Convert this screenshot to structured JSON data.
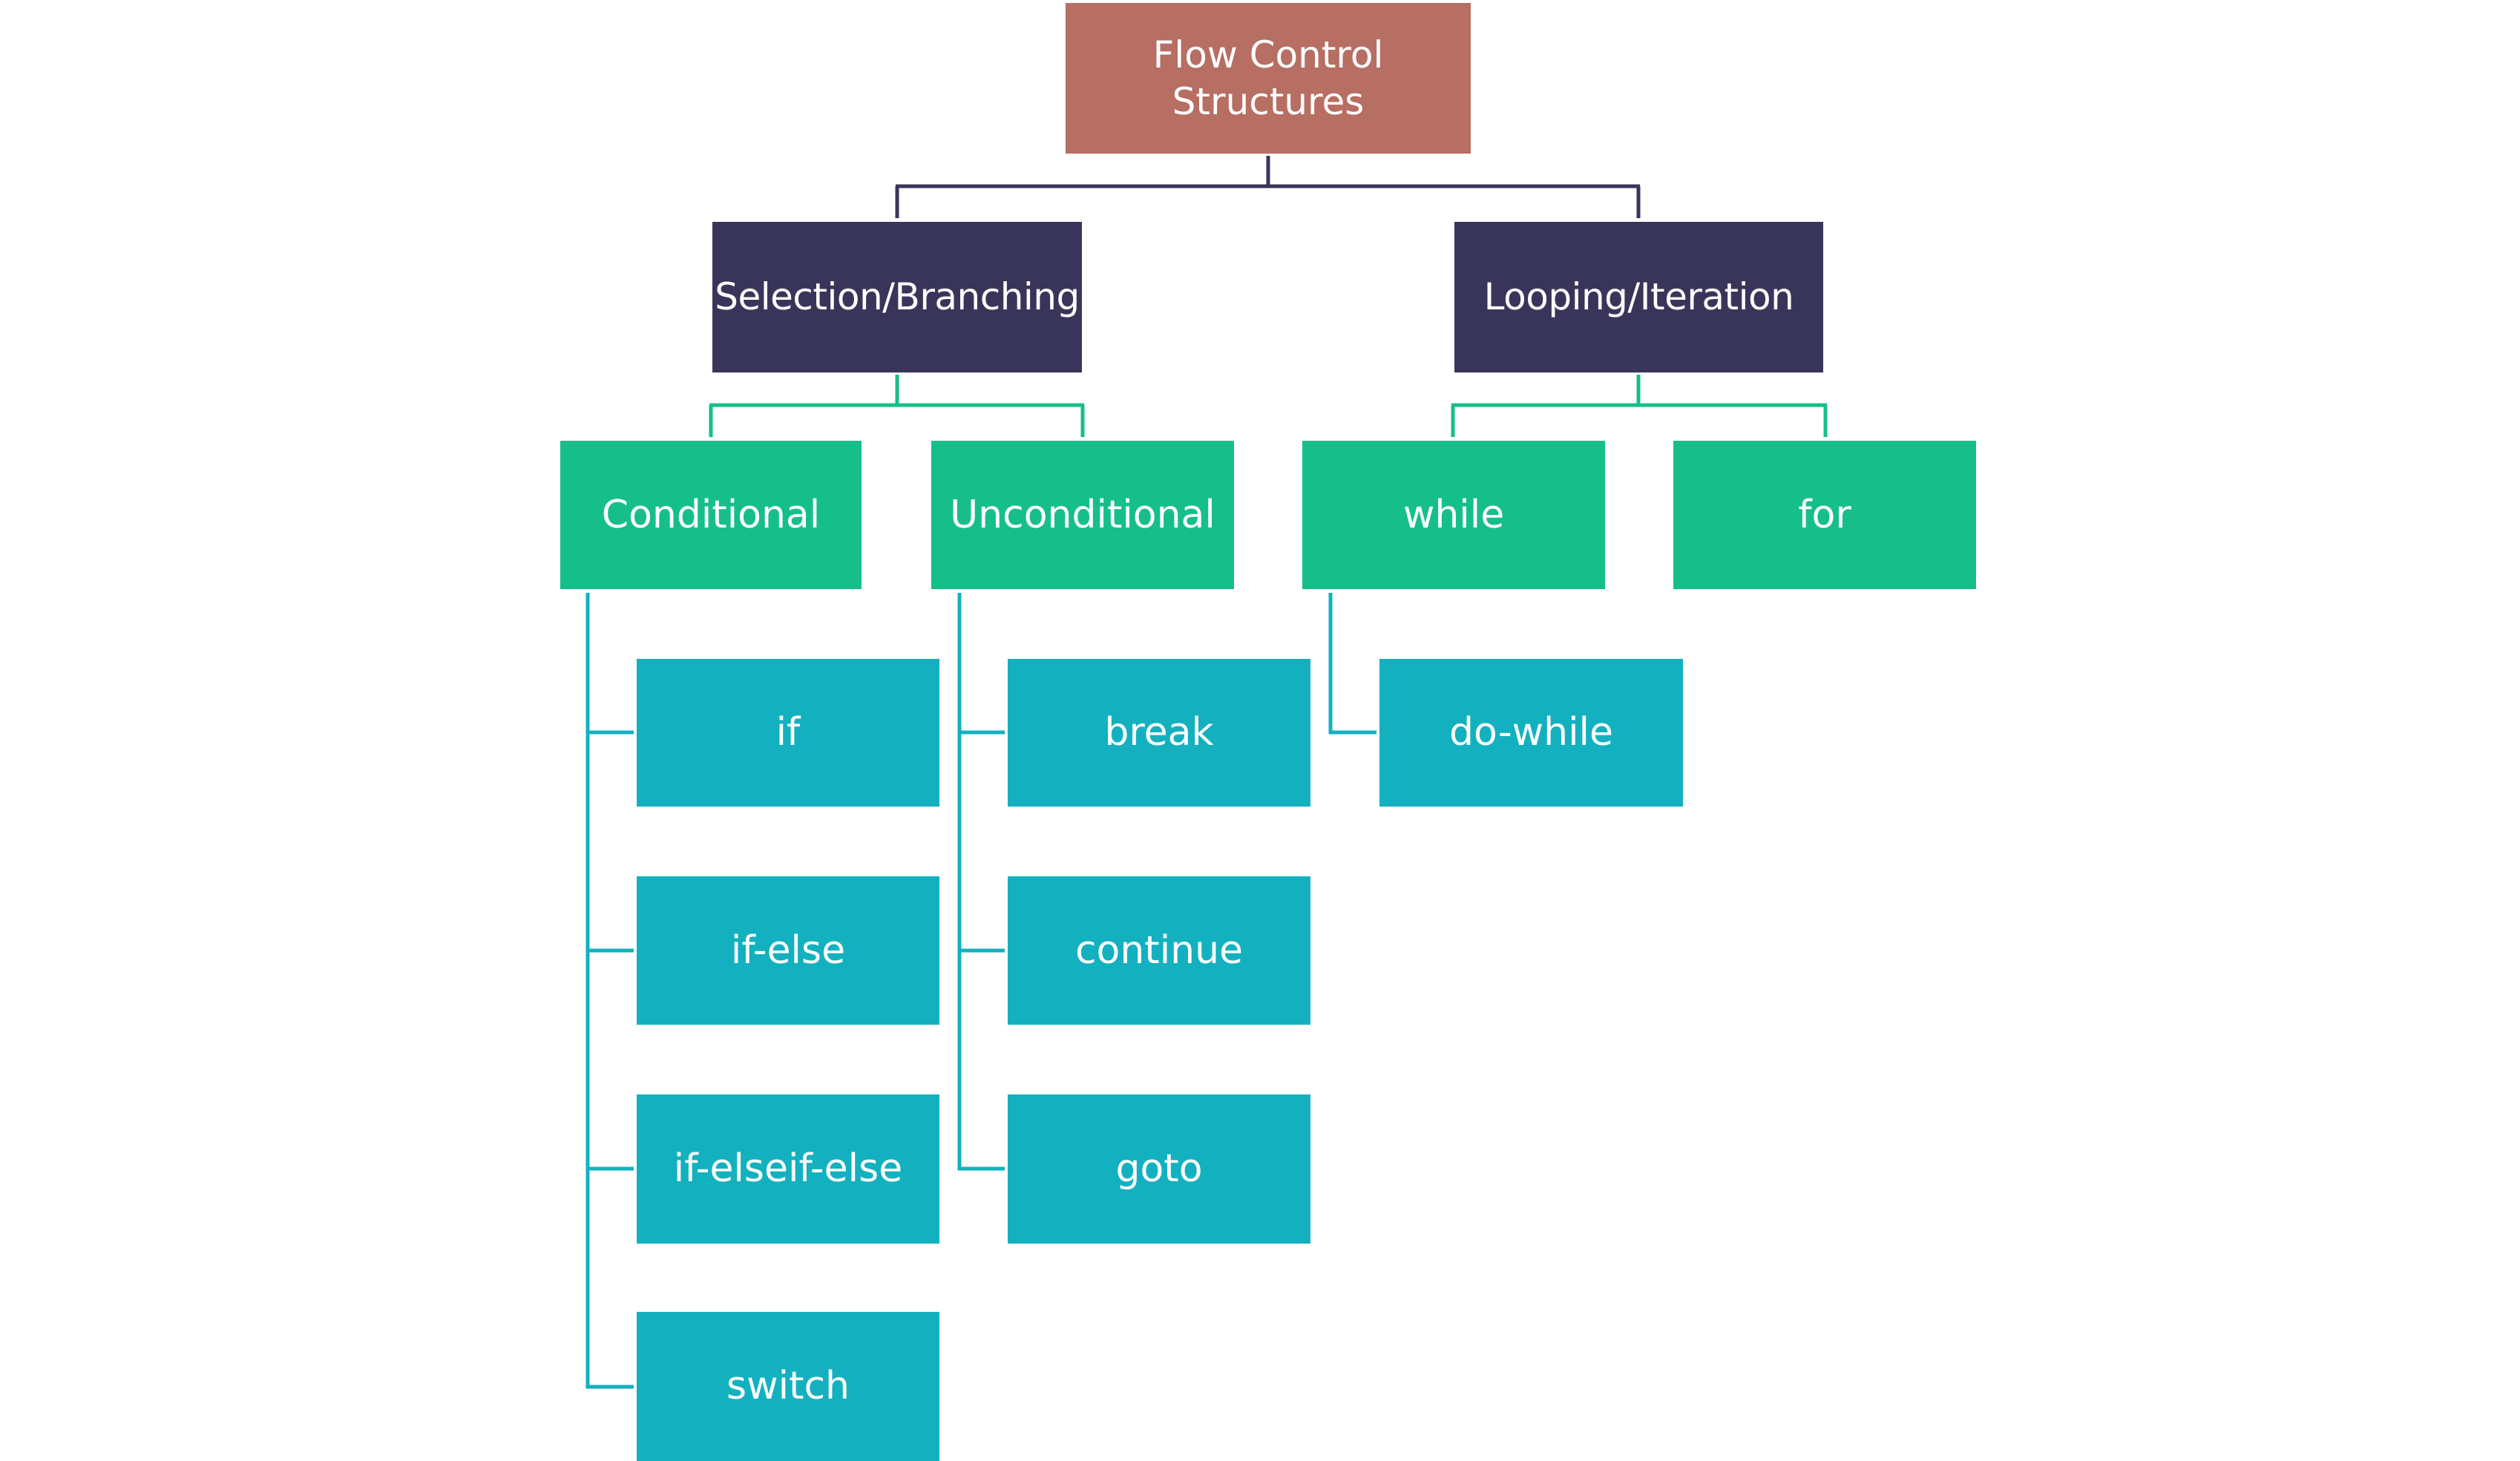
{
  "diagram": {
    "colors": {
      "root": "#B76E63",
      "category": "#39355A",
      "subcategory": "#16BF8A",
      "leaf": "#13B1C0",
      "connector_top": "#39355A",
      "connector_mid": "#16BF8A",
      "connector_leaf": "#13B1C0"
    },
    "root": {
      "label": "Flow Control Structures"
    },
    "categories": [
      {
        "label": "Selection/Branching",
        "children": [
          {
            "label": "Conditional",
            "children": [
              "if",
              "if-else",
              "if-elseif-else",
              "switch"
            ]
          },
          {
            "label": "Unconditional",
            "children": [
              "break",
              "continue",
              "goto"
            ]
          }
        ]
      },
      {
        "label": "Looping/Iteration",
        "children": [
          {
            "label": "while",
            "children": [
              "do-while"
            ]
          },
          {
            "label": "for",
            "children": []
          }
        ]
      }
    ]
  }
}
